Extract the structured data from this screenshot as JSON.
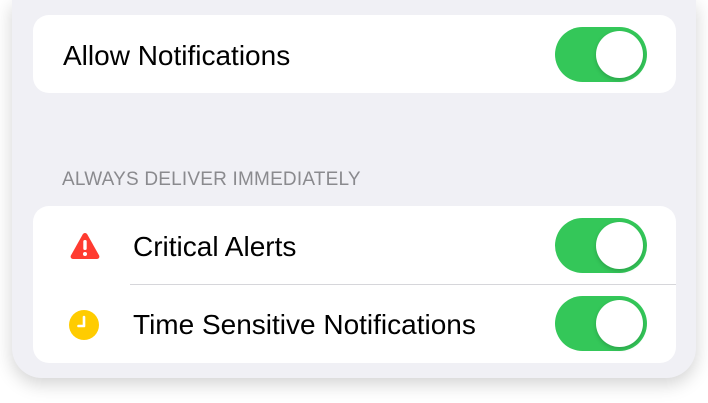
{
  "top_card": {
    "allow_notifications_label": "Allow Notifications",
    "allow_notifications_on": true
  },
  "section": {
    "header": "ALWAYS DELIVER IMMEDIATELY",
    "items": [
      {
        "label": "Critical Alerts",
        "icon": "warning-triangle-icon",
        "icon_color": "#ff3b30",
        "on": true
      },
      {
        "label": "Time Sensitive Notifications",
        "icon": "clock-icon",
        "icon_color": "#ffcc00",
        "on": true
      }
    ]
  },
  "colors": {
    "toggle_on": "#34c759",
    "background": "#f0f0f5",
    "header_text": "#8a8a8e"
  }
}
